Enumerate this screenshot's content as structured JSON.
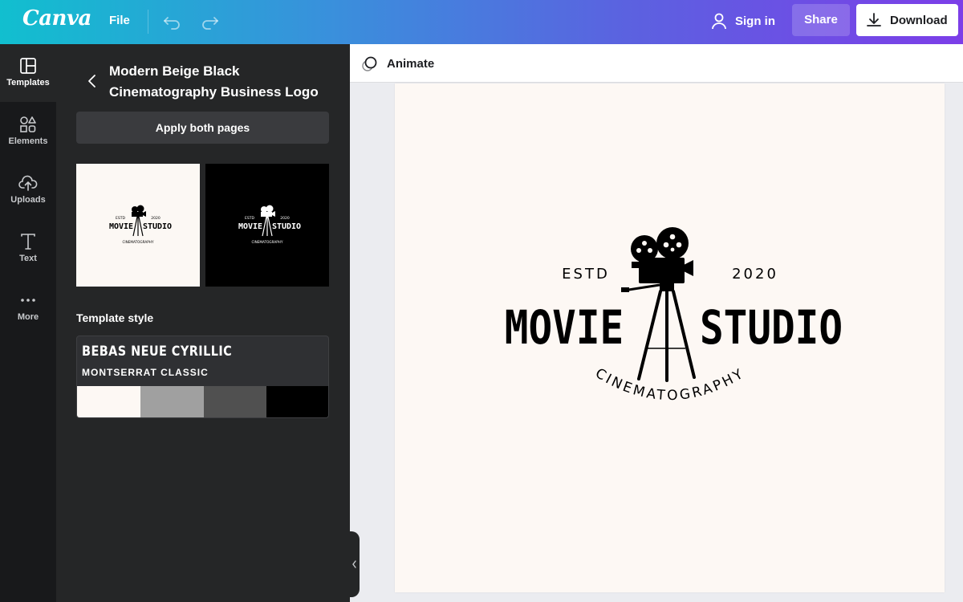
{
  "app": {
    "brand": "Canva"
  },
  "topbar": {
    "file_label": "File",
    "sign_in_label": "Sign in",
    "share_label": "Share",
    "download_label": "Download"
  },
  "rail": {
    "items": [
      {
        "label": "Templates",
        "icon": "templates-icon"
      },
      {
        "label": "Elements",
        "icon": "elements-icon"
      },
      {
        "label": "Uploads",
        "icon": "upload-icon"
      },
      {
        "label": "Text",
        "icon": "text-icon"
      },
      {
        "label": "More",
        "icon": "more-icon"
      }
    ]
  },
  "panel": {
    "title": "Modern Beige Black Cinematography Business Logo",
    "apply_label": "Apply both pages",
    "template_style_heading": "Template style",
    "font_heading": "BEBAS NEUE CYRILLIC",
    "font_body": "MONTSERRAT CLASSIC",
    "swatches": [
      "#fdf8f4",
      "#a0a0a0",
      "#505050",
      "#000000"
    ]
  },
  "editor": {
    "animate_label": "Animate"
  },
  "design": {
    "estd": "ESTD",
    "year": "2020",
    "word_left": "MOVIE",
    "word_right": "STUDIO",
    "tagline": "CINEMATOGRAPHY",
    "background": "#fdf8f4",
    "ink": "#000000"
  }
}
